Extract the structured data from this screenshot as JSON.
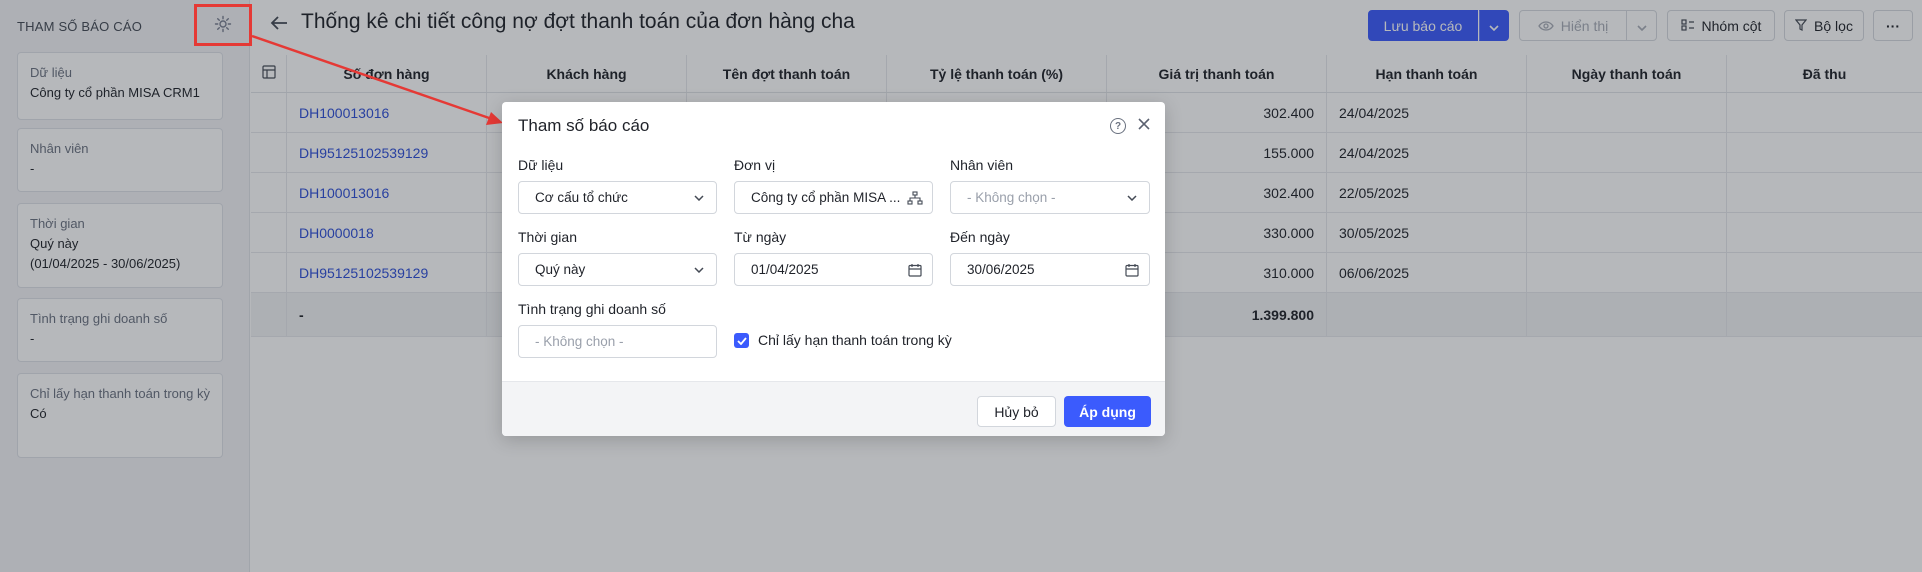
{
  "sidebar": {
    "heading": "THAM SỐ BÁO CÁO",
    "cards": [
      {
        "label": "Dữ liệu",
        "value": "Công ty cổ phần MISA CRM1"
      },
      {
        "label": "Nhân viên",
        "value": "-"
      },
      {
        "label": "Thời gian",
        "value": "Quý này",
        "value2": "(01/04/2025 - 30/06/2025)"
      },
      {
        "label": "Tình trạng ghi doanh số",
        "value": "-"
      },
      {
        "label": "Chỉ lấy hạn thanh toán trong kỳ",
        "value": "Có"
      }
    ]
  },
  "header": {
    "title": "Thống kê chi tiết công nợ đợt thanh toán của đơn hàng cha",
    "save_label": "Lưu báo cáo",
    "view_label": "Hiển thị",
    "group_label": "Nhóm cột",
    "filter_label": "Bộ lọc",
    "more_label": "···"
  },
  "table": {
    "columns": [
      "Số đơn hàng",
      "Khách hàng",
      "Tên đợt thanh toán",
      "Tỷ lệ thanh toán (%)",
      "Giá trị thanh toán",
      "Hạn thanh toán",
      "Ngày thanh toán",
      "Đã thu"
    ],
    "rows": [
      {
        "order": "DH100013016",
        "value": "302.400",
        "due": "24/04/2025"
      },
      {
        "order": "DH95125102539129",
        "value": "155.000",
        "due": "24/04/2025"
      },
      {
        "order": "DH100013016",
        "value": "302.400",
        "due": "22/05/2025"
      },
      {
        "order": "DH0000018",
        "value": "330.000",
        "due": "30/05/2025"
      },
      {
        "order": "DH95125102539129",
        "value": "310.000",
        "due": "06/06/2025"
      }
    ],
    "summary": {
      "order": "-",
      "value": "1.399.800"
    }
  },
  "modal": {
    "title": "Tham số báo cáo",
    "help_glyph": "?",
    "data_label": "Dữ liệu",
    "data_value": "Cơ cấu tổ chức",
    "unit_label": "Đơn vị",
    "unit_value": "Công ty cổ phần MISA ...",
    "staff_label": "Nhân viên",
    "staff_placeholder": "- Không chọn -",
    "time_label": "Thời gian",
    "time_value": "Quý này",
    "from_label": "Từ ngày",
    "from_value": "01/04/2025",
    "to_label": "Đến ngày",
    "to_value": "30/06/2025",
    "status_label": "Tình trạng ghi doanh số",
    "status_placeholder": "- Không chọn -",
    "checkbox_label": "Chỉ lấy hạn thanh toán trong kỳ",
    "checkbox_checked": true,
    "cancel_label": "Hủy bỏ",
    "apply_label": "Áp dụng"
  },
  "colors": {
    "accent": "#3b5bfd",
    "link": "#2f4fd8",
    "highlight": "#e53935"
  }
}
